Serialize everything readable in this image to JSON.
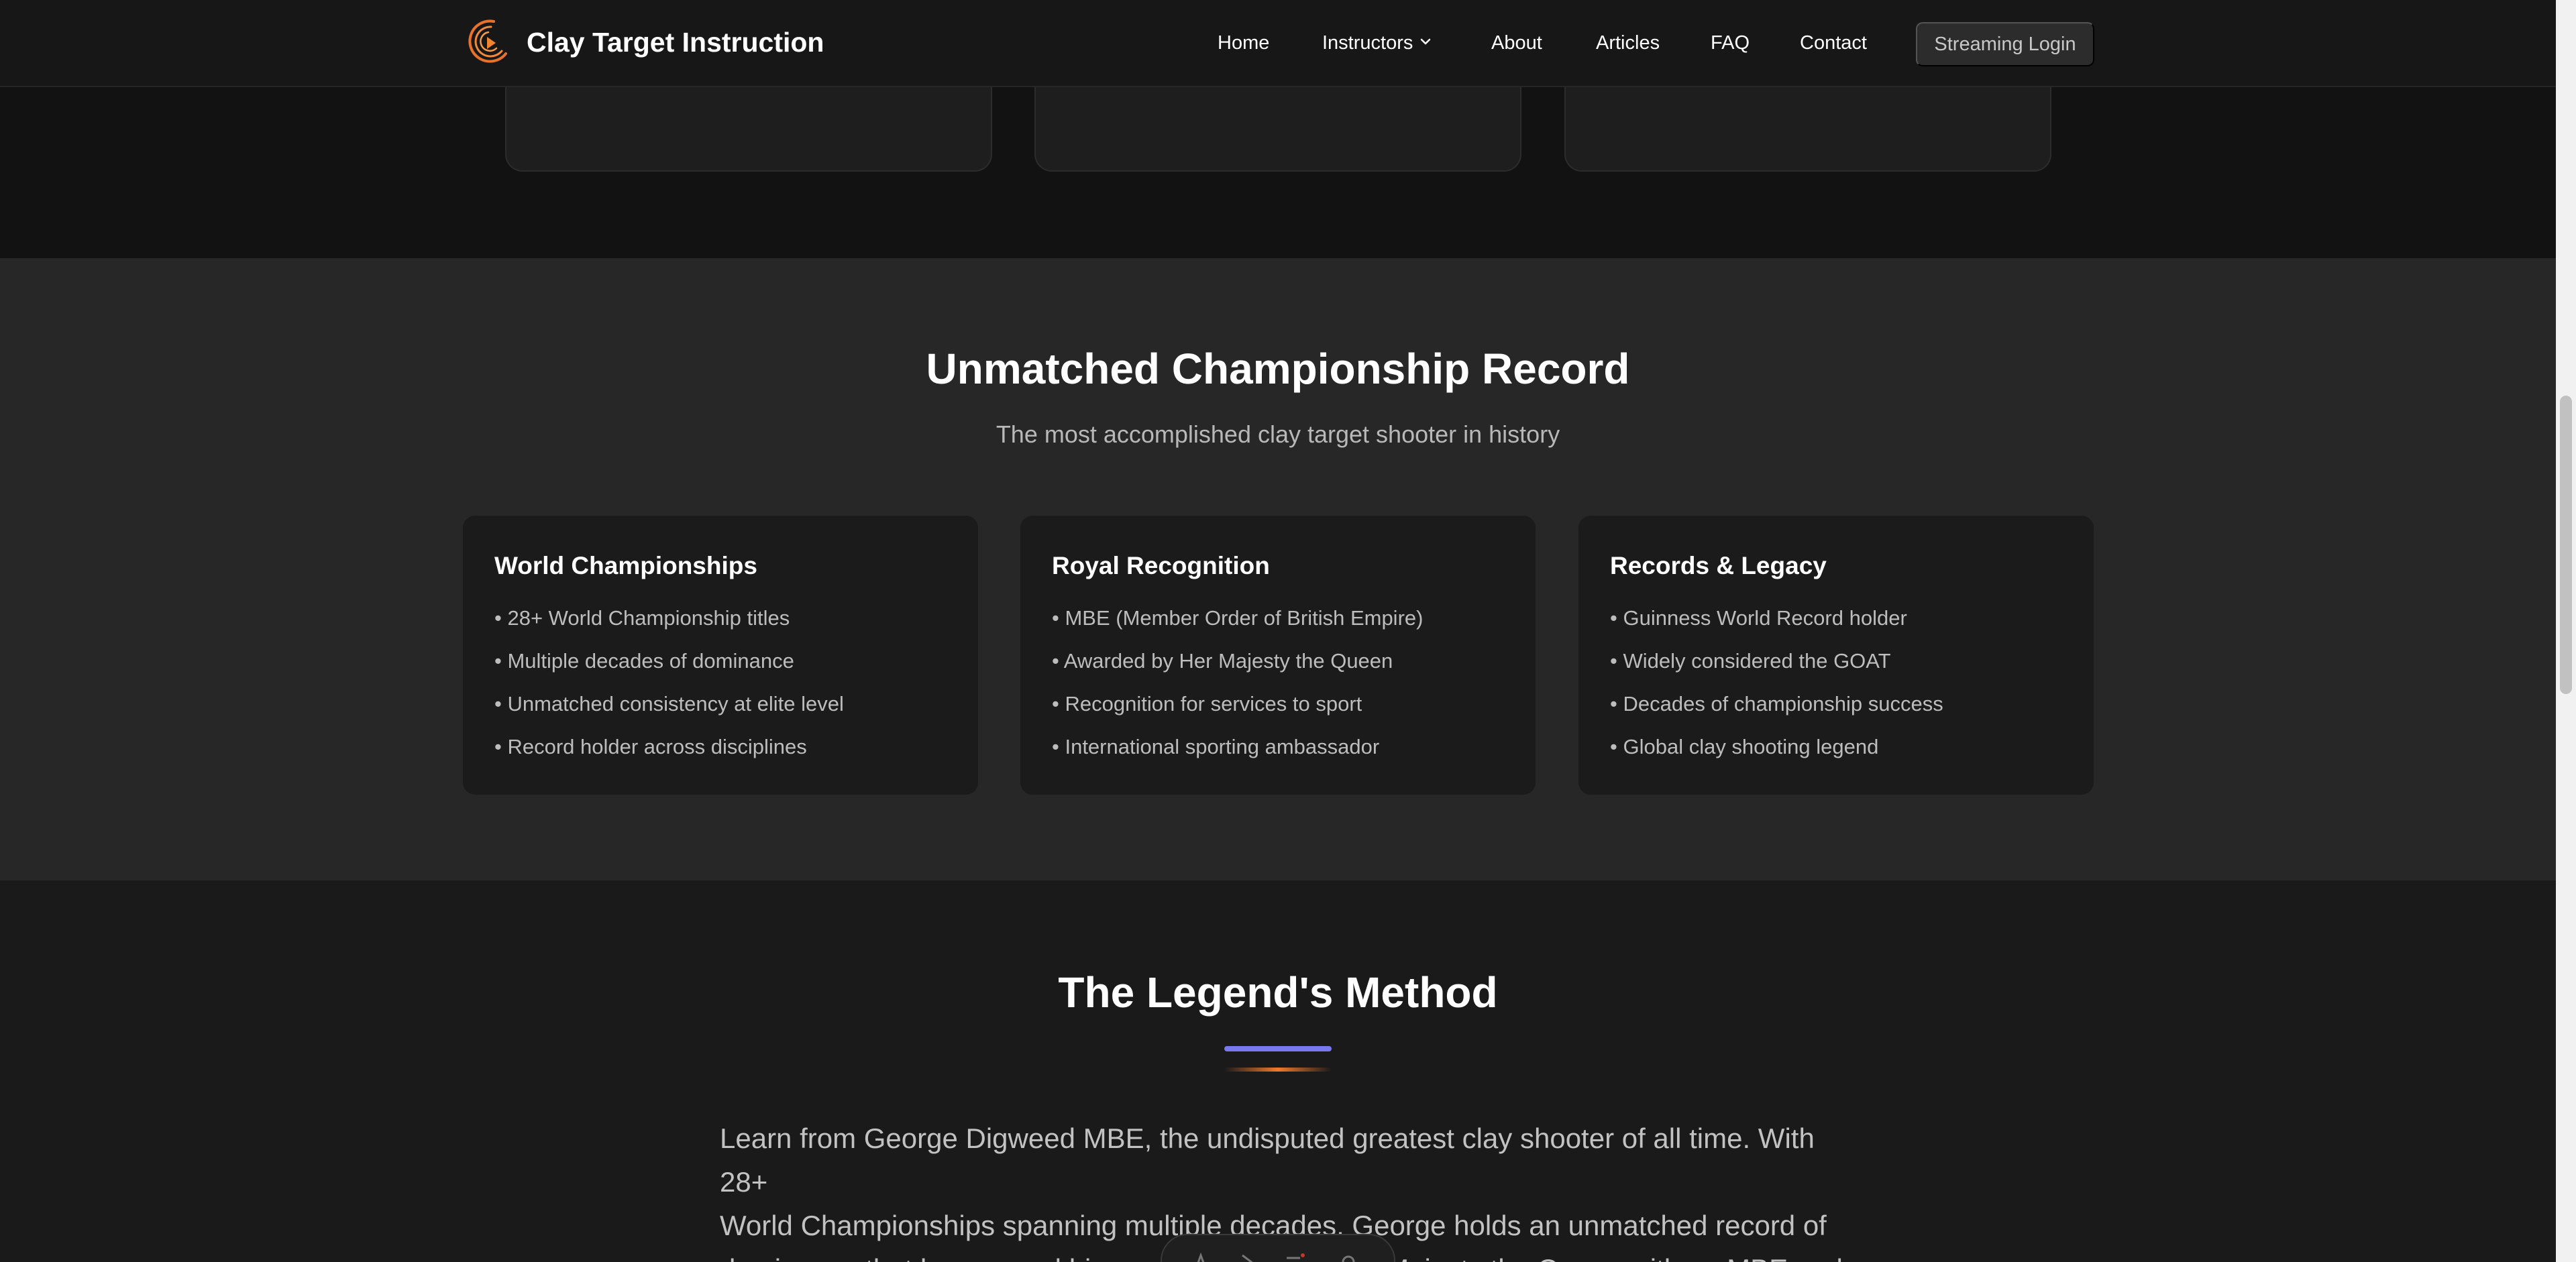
{
  "header": {
    "brand": "Clay Target Instruction",
    "nav": {
      "home": "Home",
      "instructors": "Instructors",
      "about": "About",
      "articles": "Articles",
      "faq": "FAQ",
      "contact": "Contact"
    },
    "login_label": "Streaming Login"
  },
  "championship": {
    "title": "Unmatched Championship Record",
    "subtitle": "The most accomplished clay target shooter in history",
    "panels": [
      {
        "title": "World Championships",
        "items": [
          "• 28+ World Championship titles",
          "• Multiple decades of dominance",
          "• Unmatched consistency at elite level",
          "• Record holder across disciplines"
        ]
      },
      {
        "title": "Royal Recognition",
        "items": [
          "• MBE (Member Order of British Empire)",
          "• Awarded by Her Majesty the Queen",
          "• Recognition for services to sport",
          "• International sporting ambassador"
        ]
      },
      {
        "title": "Records & Legacy",
        "items": [
          "• Guinness World Record holder",
          "• Widely considered the GOAT",
          "• Decades of championship success",
          "• Global clay shooting legend"
        ]
      }
    ]
  },
  "method": {
    "title": "The Legend's Method",
    "body_lines": [
      "Learn from George Digweed MBE, the undisputed greatest clay shooter of all time. With 28+",
      "World Championships spanning multiple decades, George holds an unmatched record of",
      "dominance that has earned him recognition from Her Majesty the Queen with an MBE and"
    ]
  },
  "icons": {
    "logo": "play-circle-logo-icon",
    "dropdown": "chevron-down-icon"
  },
  "colors": {
    "accent_orange": "#f07a2a",
    "accent_purple": "#7a78ee",
    "page_bg": "#1b1b1b",
    "section_bg": "#272727"
  }
}
